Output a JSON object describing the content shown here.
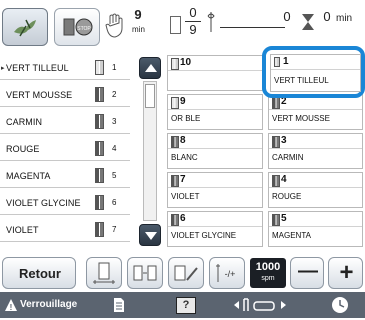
{
  "top": {
    "fraction_top": "9",
    "fraction_unit": "min",
    "needle_fraction_num": "0",
    "needle_fraction_den": "9",
    "time_value": "0",
    "time_unit": "min"
  },
  "thread_list": [
    {
      "name": "VERT TILLEUL",
      "num": "1"
    },
    {
      "name": "VERT MOUSSE",
      "num": "2"
    },
    {
      "name": "CARMIN",
      "num": "3"
    },
    {
      "name": "ROUGE",
      "num": "4"
    },
    {
      "name": "MAGENTA",
      "num": "5"
    },
    {
      "name": "VIOLET GLYCINE",
      "num": "6"
    },
    {
      "name": "VIOLET",
      "num": "7"
    }
  ],
  "grid_col1": [
    {
      "num": "10",
      "name": ""
    },
    {
      "num": "9",
      "name": "OR BLE"
    },
    {
      "num": "8",
      "name": "BLANC"
    },
    {
      "num": "7",
      "name": "VIOLET"
    },
    {
      "num": "6",
      "name": "VIOLET GLYCINE"
    }
  ],
  "grid_col2": [
    {
      "num": "1",
      "name": "VERT TILLEUL"
    },
    {
      "num": "2",
      "name": "VERT MOUSSE"
    },
    {
      "num": "3",
      "name": "CARMIN"
    },
    {
      "num": "4",
      "name": "ROUGE"
    },
    {
      "num": "5",
      "name": "MAGENTA"
    }
  ],
  "bottom": {
    "back_label": "Retour",
    "speed_value": "1000",
    "speed_unit": "spm",
    "minus": "—",
    "plus": "+"
  },
  "footer": {
    "lock_label": "Verrouillage"
  },
  "colors": {
    "highlight": "#1a86d6",
    "footer_bg": "#5b6470"
  }
}
